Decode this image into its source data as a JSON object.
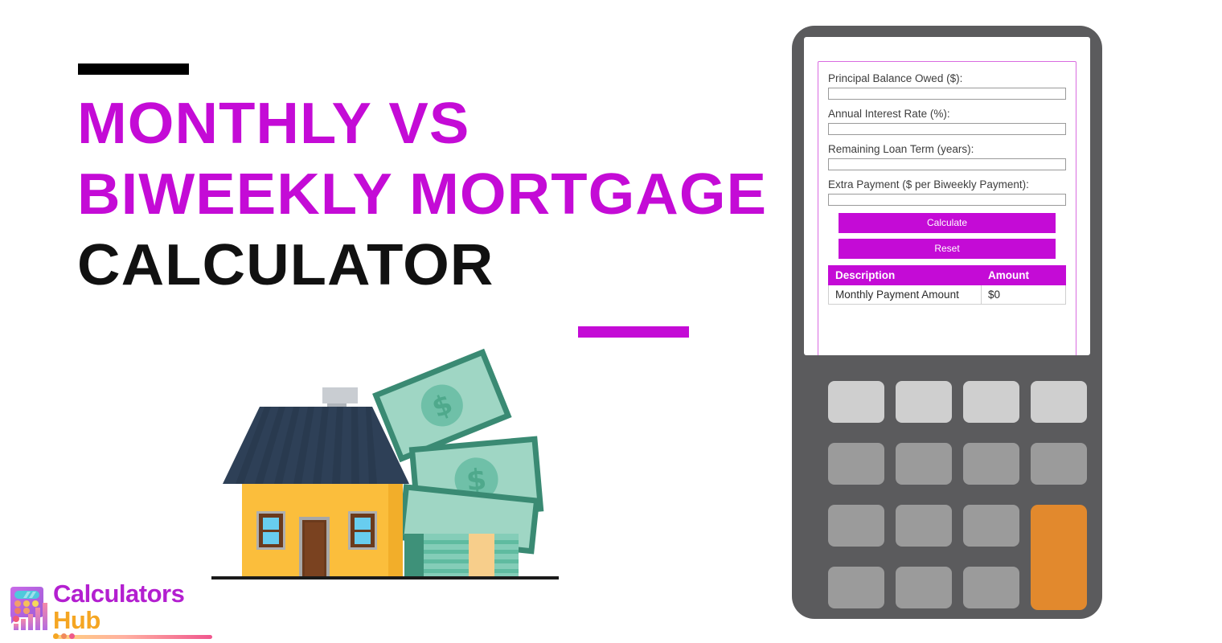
{
  "headline": {
    "line1": "MONTHLY VS",
    "line2": "BIWEEKLY MORTGAGE",
    "line3": "CALCULATOR"
  },
  "colors": {
    "accent_purple": "#C40BD6",
    "headline_black": "#111111",
    "device_body": "#5B5B5D",
    "key_light": "#CFCFCF",
    "key_gray": "#9B9B9B",
    "key_orange": "#E2892D",
    "logo_purple": "#B31FD0",
    "logo_orange": "#F5A623"
  },
  "logo": {
    "word1": "Calculators",
    "word2": "Hub",
    "icon": "calculator-bar-chart-icon"
  },
  "calculator_form": {
    "fields": [
      {
        "label": "Principal Balance Owed ($):",
        "value": "",
        "placeholder": "",
        "name": "principal-balance-input"
      },
      {
        "label": "Annual Interest Rate (%):",
        "value": "",
        "placeholder": "",
        "name": "annual-interest-rate-input"
      },
      {
        "label": "Remaining Loan Term (years):",
        "value": "",
        "placeholder": "",
        "name": "remaining-loan-term-input"
      },
      {
        "label": "Extra Payment ($ per Biweekly Payment):",
        "value": "",
        "placeholder": "",
        "name": "extra-payment-input"
      }
    ],
    "calculate_label": "Calculate",
    "reset_label": "Reset",
    "results": {
      "headers": [
        "Description",
        "Amount"
      ],
      "rows": [
        [
          "Monthly Payment Amount",
          "$0"
        ]
      ]
    }
  },
  "keypad": {
    "rows": [
      [
        {
          "tone": "light"
        },
        {
          "tone": "light"
        },
        {
          "tone": "light"
        },
        {
          "tone": "light"
        }
      ],
      [
        {
          "tone": "gray"
        },
        {
          "tone": "gray"
        },
        {
          "tone": "gray"
        },
        {
          "tone": "gray"
        }
      ],
      [
        {
          "tone": "gray"
        },
        {
          "tone": "gray"
        },
        {
          "tone": "gray"
        },
        {
          "tone": "orange"
        }
      ],
      [
        {
          "tone": "gray"
        },
        {
          "tone": "gray"
        },
        {
          "tone": "gray"
        }
      ]
    ]
  },
  "illustration": {
    "name": "house-with-money-illustration",
    "elements": [
      "house",
      "roof",
      "chimney",
      "door",
      "windows",
      "dollar-bills",
      "bill-stack",
      "ground-line"
    ]
  },
  "decor": {
    "top_dash": "black-dash",
    "mid_dash": "purple-dash"
  }
}
